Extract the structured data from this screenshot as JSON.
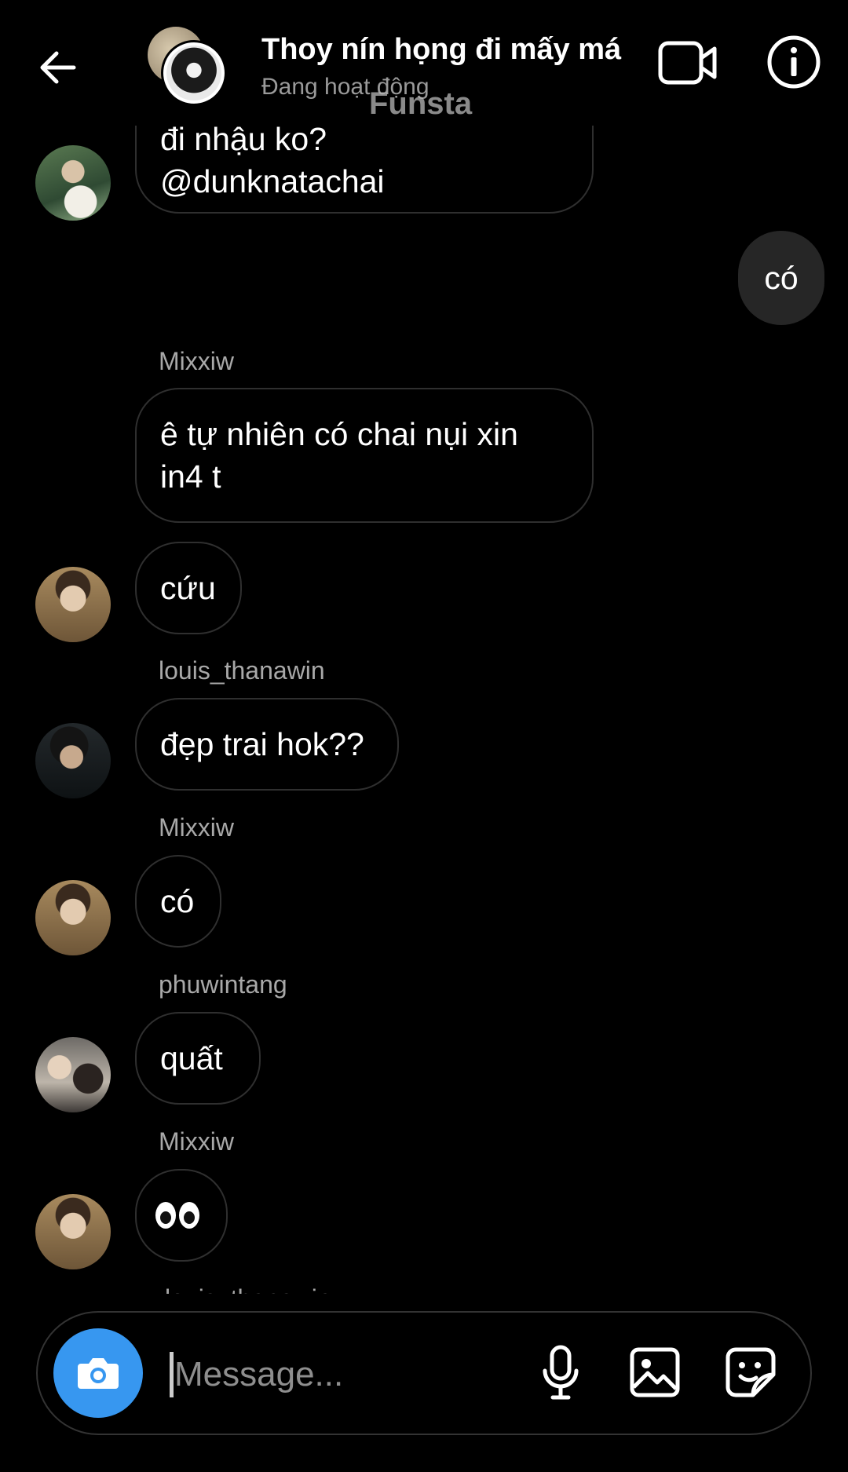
{
  "header": {
    "title": "Thoy nín họng đi mấy má",
    "status": "Đang hoạt động",
    "watermark": "Funsta",
    "icons": [
      "back-arrow-icon",
      "video-call-icon",
      "info-icon"
    ]
  },
  "messages": {
    "m0_line1": "đi nhậu ko?",
    "m0_line2": "@dunknatachai",
    "m1_sent": "có",
    "m2_sender": "Mixxiw",
    "m2_text": "ê tự nhiên có chai nụi xin in4 t",
    "m3_text": "cứu",
    "m4_sender": "louis_thanawin",
    "m4_text": "đẹp trai hok??",
    "m5_sender": "Mixxiw",
    "m5_text": "có",
    "m6_sender": "phuwintang",
    "m6_text": "quất",
    "m7_sender": "Mixxiw",
    "m7_emoji": "👀",
    "m8_sender_cut": "louis_thanawin"
  },
  "composer": {
    "placeholder": "Message...",
    "icons": [
      "camera-icon",
      "microphone-icon",
      "gallery-icon",
      "sticker-icon"
    ]
  },
  "colors": {
    "background": "#000000",
    "sent_bubble": "#262626",
    "accent": "#3797f0",
    "bubble_border": "#2f2f2f"
  }
}
